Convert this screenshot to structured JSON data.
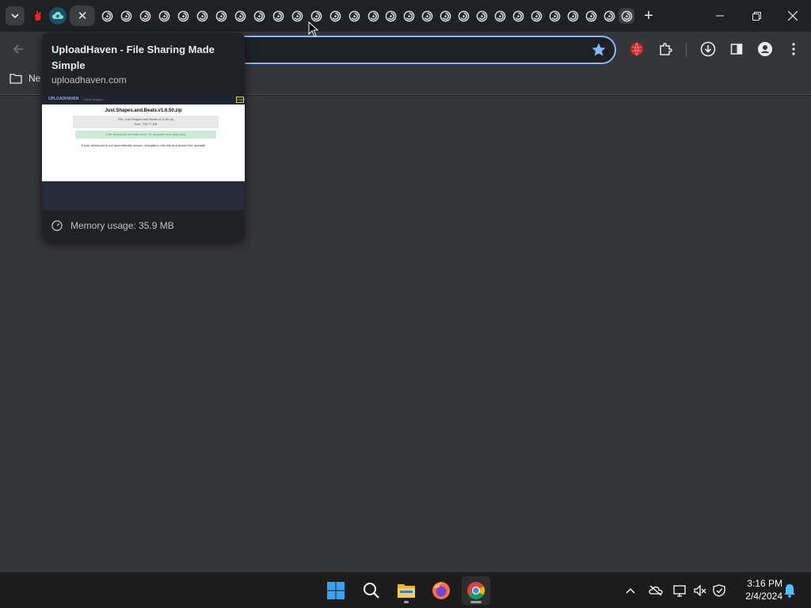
{
  "browser": {
    "tabs_count_visible": 31,
    "active_tab_close": "✕",
    "new_tab": "+"
  },
  "toolbar": {
    "omnibox_value": ""
  },
  "bookmarks": {
    "folder_label": "Ne"
  },
  "hovercard": {
    "title": "UploadHaven - File Sharing Made Simple",
    "domain": "uploadhaven.com",
    "memory": "Memory usage: 35.9 MB",
    "preview": {
      "logo": "UPLOADHAVEN",
      "nav": "Home   Support",
      "login": "Login",
      "filename": "Just.Shapes.and.Beats.v1.6.50.zip",
      "file_line": "File: Just.Shapes.and.Beats.v1.6.50.zip",
      "size_line": "Size: 795.77 MB",
      "green_text": "Free download will start soon. Or upgrade now (skip ads)",
      "note": "If your download is not automatically shown, navigate to this link and accept the Uploadh"
    }
  },
  "taskbar": {
    "time": "3:16 PM",
    "date": "2/4/2024"
  },
  "colors": {
    "accent": "#8ab4f8",
    "star": "#8ab4f8",
    "win_blue": "#1e90ff"
  }
}
